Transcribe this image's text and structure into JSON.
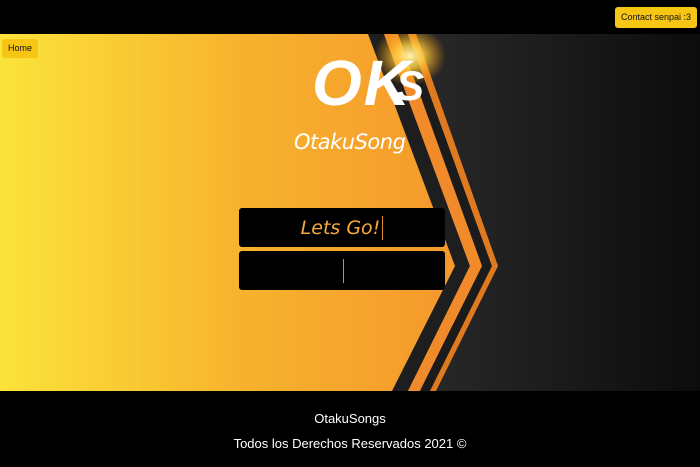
{
  "nav": {
    "home_label": "Home",
    "contact_label": "Contact senpai :3"
  },
  "hero": {
    "logo_main": "OK",
    "logo_tail": "S",
    "subtitle": "OtakuSong",
    "primary_field": {
      "text": "Lets Go!"
    },
    "secondary_field": {
      "text": ""
    }
  },
  "footer": {
    "brand": "OtakuSongs",
    "rights": "Todos los Derechos Reservados 2021 ©"
  },
  "colors": {
    "accent": "#f7c513",
    "gradient_left": "#fbe33a",
    "gradient_right": "#f27a2c",
    "dark": "#111111"
  }
}
